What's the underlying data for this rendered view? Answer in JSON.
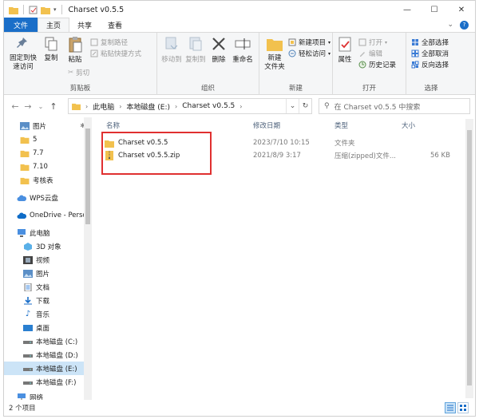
{
  "window": {
    "title": "Charset v0.5.5",
    "min": "—",
    "max": "☐",
    "close": "✕"
  },
  "ribbon_tabs": [
    {
      "label": "文件"
    },
    {
      "label": "主页"
    },
    {
      "label": "共享"
    },
    {
      "label": "查看"
    }
  ],
  "ribbon": {
    "clipboard": {
      "label": "剪贴板",
      "pin": "固定到快\n速访问",
      "copy": "复制",
      "paste": "粘贴",
      "copy_path": "复制路径",
      "paste_shortcut": "粘贴快捷方式",
      "cut": "剪切"
    },
    "organize": {
      "label": "组织",
      "move_to": "移动到",
      "copy_to": "复制到",
      "delete": "删除",
      "rename": "重命名"
    },
    "new": {
      "label": "新建",
      "new_folder": "新建\n文件夹",
      "new_item": "新建项目",
      "easy_access": "轻松访问"
    },
    "open": {
      "label": "打开",
      "properties": "属性",
      "open": "打开",
      "edit": "编辑",
      "history": "历史记录"
    },
    "select": {
      "label": "选择",
      "select_all": "全部选择",
      "select_none": "全部取消",
      "invert": "反向选择"
    }
  },
  "address": {
    "crumbs": [
      "此电脑",
      "本地磁盘 (E:)",
      "Charset v0.5.5"
    ],
    "search_placeholder": "在 Charset v0.5.5 中搜索"
  },
  "nav": {
    "items": [
      {
        "label": "图片",
        "icon": "pictures-icon"
      },
      {
        "label": "5",
        "icon": "folder-icon"
      },
      {
        "label": "7.7",
        "icon": "folder-icon"
      },
      {
        "label": "7.10",
        "icon": "folder-icon"
      },
      {
        "label": "考核表",
        "icon": "folder-icon"
      },
      {
        "label": "WPS云盘",
        "icon": "cloud-icon"
      },
      {
        "label": "OneDrive - Perso",
        "icon": "onedrive-icon"
      },
      {
        "label": "此电脑",
        "icon": "computer-icon"
      },
      {
        "label": "3D 对象",
        "icon": "3d-objects-icon"
      },
      {
        "label": "视频",
        "icon": "video-icon"
      },
      {
        "label": "图片",
        "icon": "pictures-icon"
      },
      {
        "label": "文档",
        "icon": "documents-icon"
      },
      {
        "label": "下载",
        "icon": "download-icon"
      },
      {
        "label": "音乐",
        "icon": "music-icon"
      },
      {
        "label": "桌面",
        "icon": "desktop-icon"
      },
      {
        "label": "本地磁盘 (C:)",
        "icon": "drive-icon"
      },
      {
        "label": "本地磁盘 (D:)",
        "icon": "drive-icon"
      },
      {
        "label": "本地磁盘 (E:)",
        "icon": "drive-icon"
      },
      {
        "label": "本地磁盘 (F:)",
        "icon": "drive-icon"
      },
      {
        "label": "网络",
        "icon": "network-icon"
      }
    ]
  },
  "columns": {
    "name": "名称",
    "modified": "修改日期",
    "type": "类型",
    "size": "大小"
  },
  "files": [
    {
      "name": "Charset v0.5.5",
      "modified": "2023/7/10 10:15",
      "type": "文件夹",
      "size": ""
    },
    {
      "name": "Charset v0.5.5.zip",
      "modified": "2021/8/9 3:17",
      "type": "压缩(zipped)文件...",
      "size": "56 KB"
    }
  ],
  "status": {
    "count": "2 个项目"
  },
  "colors": {
    "accent": "#1a6ec8",
    "selection": "#cce4f7",
    "highlight_box": "#e03030",
    "folder": "#f2c14e"
  }
}
